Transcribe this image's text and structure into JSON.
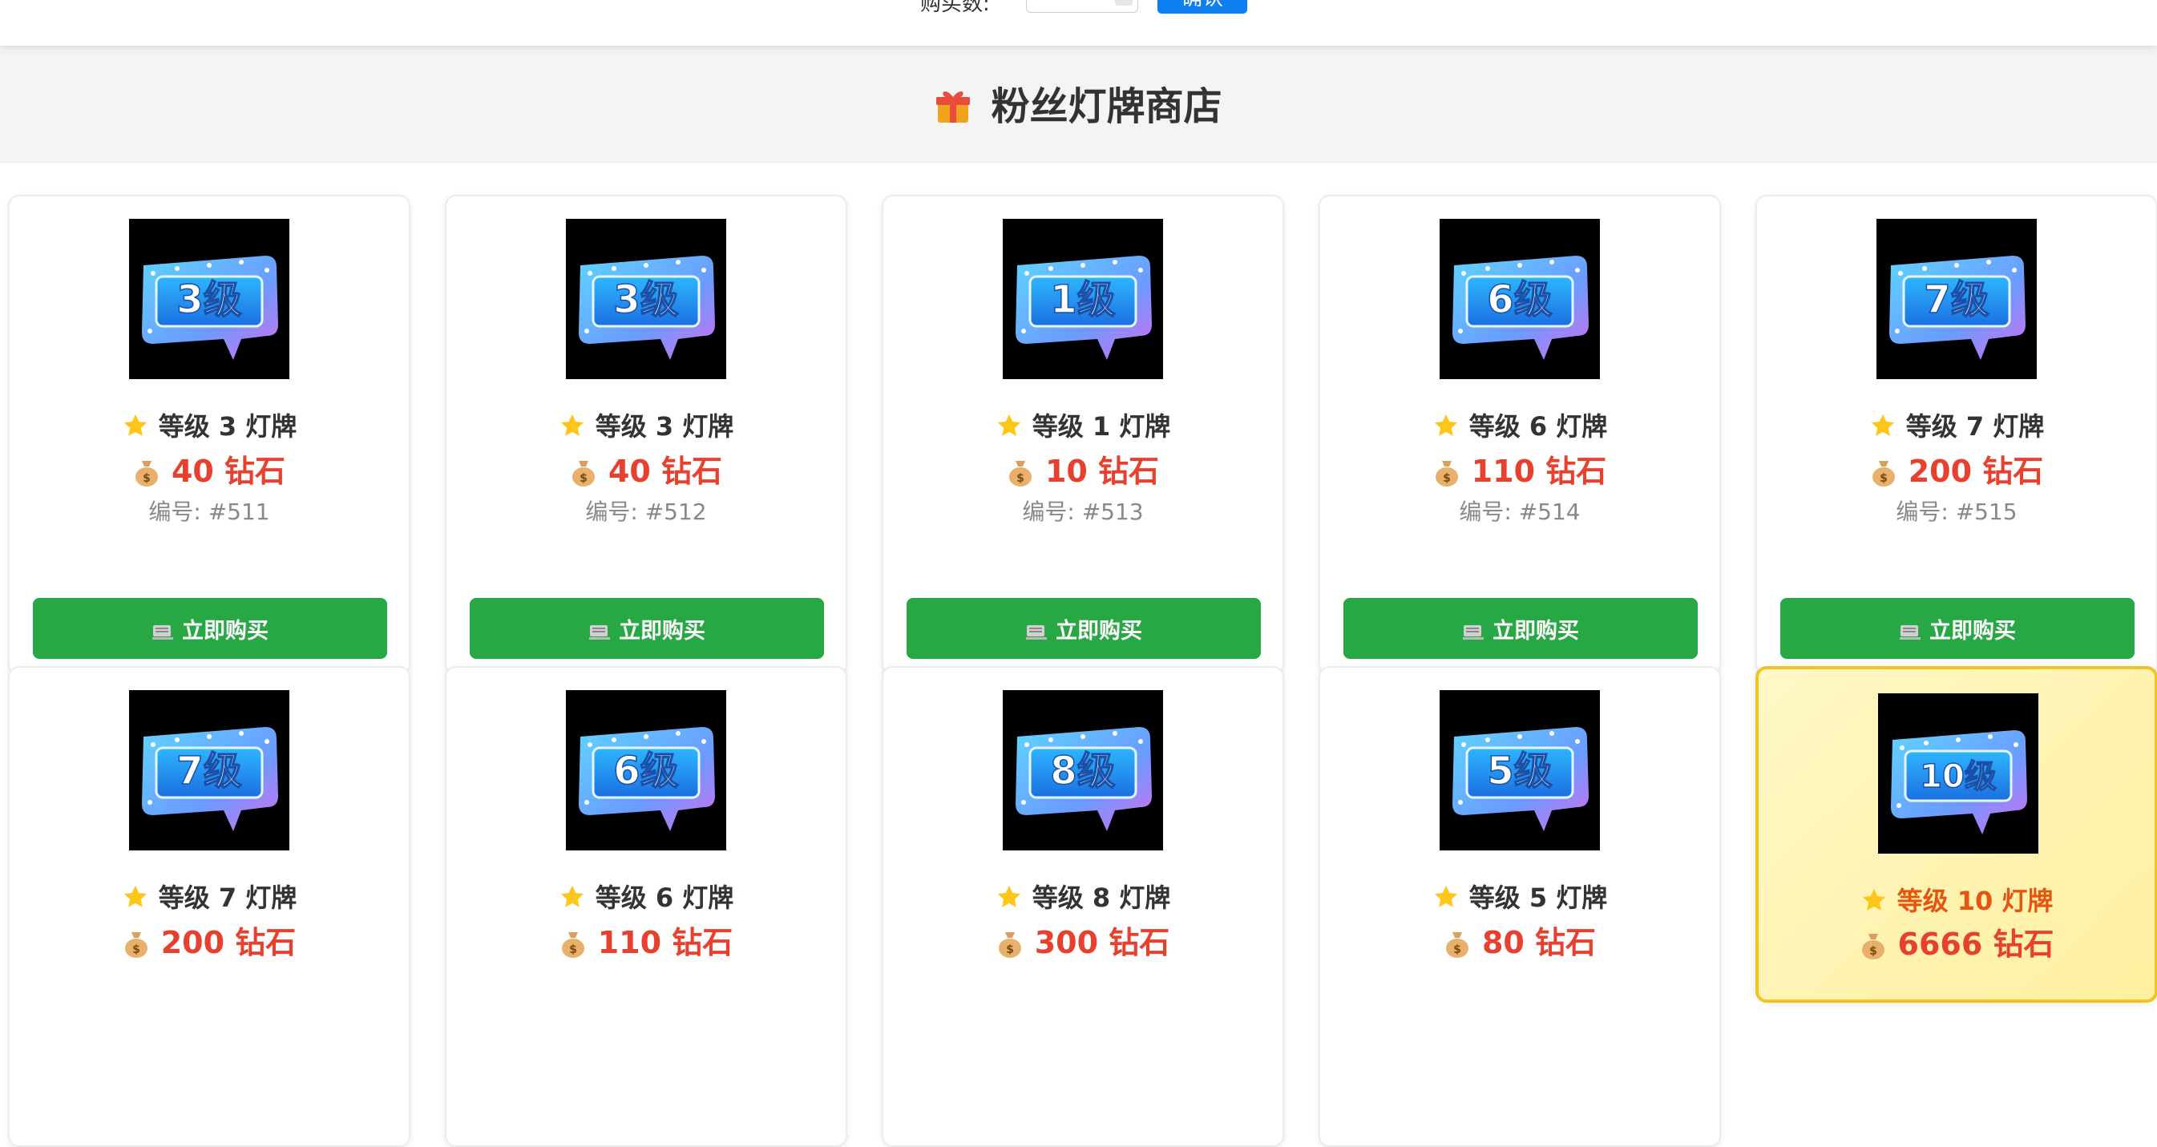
{
  "topbar": {
    "label": "购买数:",
    "button": "确认"
  },
  "shop": {
    "title": "粉丝灯牌商店",
    "icon": "gift-icon"
  },
  "card_labels": {
    "level_prefix": "等级",
    "level_suffix": "灯牌",
    "currency": "钻石",
    "id_prefix": "编号:",
    "buy": "立即购买",
    "badge_suffix": "级"
  },
  "products": [
    {
      "level": 3,
      "price": 40,
      "id": "#511",
      "premium": false
    },
    {
      "level": 3,
      "price": 40,
      "id": "#512",
      "premium": false
    },
    {
      "level": 1,
      "price": 10,
      "id": "#513",
      "premium": false
    },
    {
      "level": 6,
      "price": 110,
      "id": "#514",
      "premium": false
    },
    {
      "level": 7,
      "price": 200,
      "id": "#515",
      "premium": false
    },
    {
      "level": 7,
      "price": 200,
      "id": "",
      "premium": false
    },
    {
      "level": 6,
      "price": 110,
      "id": "",
      "premium": false
    },
    {
      "level": 8,
      "price": 300,
      "id": "",
      "premium": false
    },
    {
      "level": 5,
      "price": 80,
      "id": "",
      "premium": false
    },
    {
      "level": 10,
      "price": 6666,
      "id": "",
      "premium": true
    }
  ],
  "colors": {
    "buy_button": "#28a745",
    "price": "#e8402e",
    "premium_level": "#e4560f",
    "premium_border": "#f2c420",
    "accent_button": "#0d7ff0"
  }
}
